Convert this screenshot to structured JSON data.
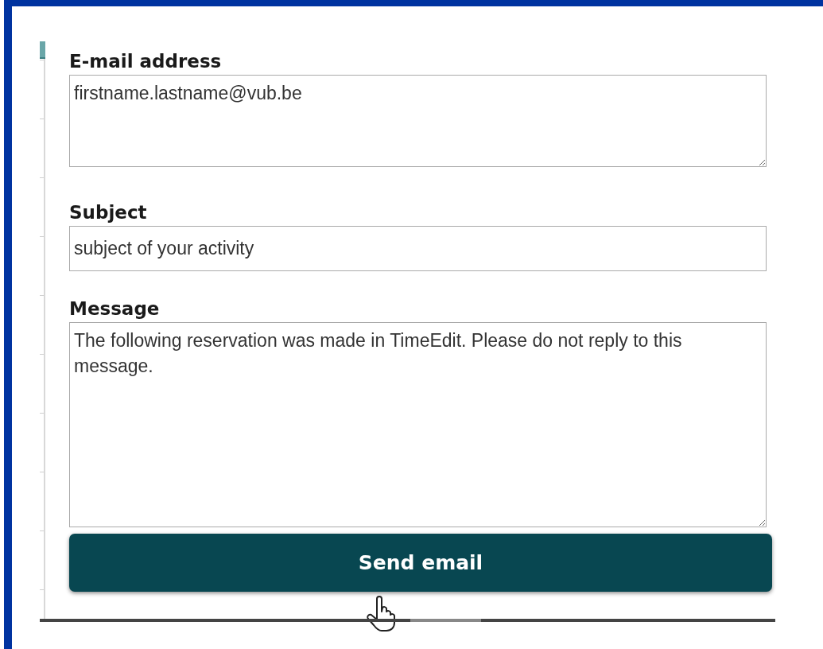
{
  "form": {
    "fields": [
      {
        "label": "E-mail address",
        "kind": "multiline",
        "value": "firstname.lastname@vub.be"
      },
      {
        "label": "Subject",
        "kind": "single",
        "value": "subject of your activity"
      },
      {
        "label": "Message",
        "kind": "multiline-tall",
        "value": "The following reservation was made in TimeEdit. Please do not reply to this message."
      }
    ],
    "submit": {
      "label": "Send email"
    }
  }
}
